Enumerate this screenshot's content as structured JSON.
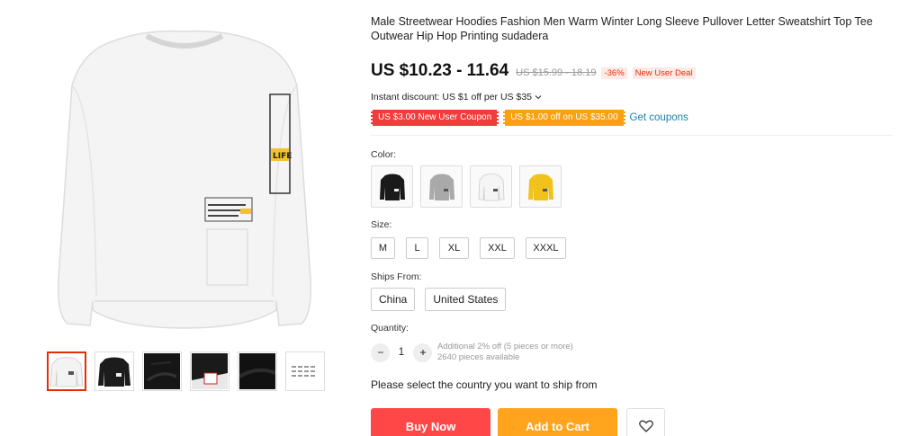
{
  "product": {
    "title": "Male Streetwear Hoodies Fashion Men Warm Winter Long Sleeve Pullover Letter Sweatshirt Top Tee Outwear Hip Hop Printing sudadera",
    "price": "US $10.23 - 11.64",
    "old_price": "US $15.99 - 18.19",
    "discount": "-36%",
    "deal_badge": "New User Deal",
    "instant_discount": "Instant discount: US $1 off per US $35",
    "coupons": [
      "US $3.00 New User Coupon",
      "US $1.00 off on US $35.00"
    ],
    "get_coupons": "Get coupons"
  },
  "options": {
    "color_label": "Color:",
    "colors": [
      {
        "name": "black",
        "hex": "#1a1a1a"
      },
      {
        "name": "gray",
        "hex": "#a9a9a9"
      },
      {
        "name": "white",
        "hex": "#f5f5f5"
      },
      {
        "name": "yellow",
        "hex": "#f1c21b"
      }
    ],
    "size_label": "Size:",
    "sizes": [
      "M",
      "L",
      "XL",
      "XXL",
      "XXXL"
    ],
    "ships_label": "Ships From:",
    "ships_from": [
      "China",
      "United States"
    ],
    "quantity_label": "Quantity:",
    "quantity": "1",
    "qty_note_1": "Additional 2% off (5 pieces or more)",
    "qty_note_2": "2640 pieces available",
    "ship_message": "Please select the country you want to ship from"
  },
  "actions": {
    "buy_now": "Buy Now",
    "add_to_cart": "Add to Cart",
    "wishlist_icon": "heart-icon"
  },
  "gallery": {
    "thumbnails": [
      "white-sweatshirt",
      "black-sweatshirt",
      "black-fabric-detail",
      "print-detail",
      "black-fabric-closeup",
      "size-chart"
    ]
  },
  "colors": {
    "accent": "#ff4747",
    "cart": "#ffa41c",
    "link": "#1a7fb0",
    "selected_thumb": "#e62e04"
  }
}
